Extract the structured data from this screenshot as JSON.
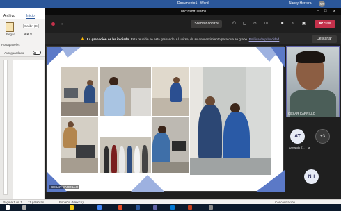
{
  "word": {
    "title": "Documento1 - Word",
    "user": "Nancy Herrera",
    "user_initials": "NH",
    "tabs": [
      "Archivo",
      "Inicio"
    ],
    "ribbon": {
      "paste_label": "Pegar",
      "font_name": "Calibri (C",
      "format_buttons": "N  K  S",
      "clipboard_label": "Portapapeles",
      "autosave_label": "Autoguardado"
    },
    "status": {
      "page": "Página 1 de 1",
      "words": "11 palabras",
      "language": "Español (México)",
      "focus": "Concentración"
    }
  },
  "teams": {
    "title": "Microsoft Teams",
    "timer": "--:--",
    "control_button": "Solicitar control",
    "leave_button": "Salir",
    "notice": {
      "bold": "La grabación se ha iniciado.",
      "text": "Esta reunión se está grabando. Al unirse, da su consentimiento para que se grabe.",
      "link": "Política de privacidad"
    },
    "dismiss_button": "Descartar",
    "presenter": "CESAR CARRILLO",
    "self_name": "CESAR CARRILLO",
    "participants": [
      {
        "initials": "AT",
        "label": "Armando T..."
      },
      {
        "initials": "+3",
        "label": ""
      },
      {
        "initials": "NH",
        "label": ""
      }
    ]
  },
  "colors": {
    "teams_accent": "#6264a7",
    "leave_red": "#c4314b",
    "word_blue": "#2b579a",
    "slide_triangle_blue": "#5b79c7"
  }
}
